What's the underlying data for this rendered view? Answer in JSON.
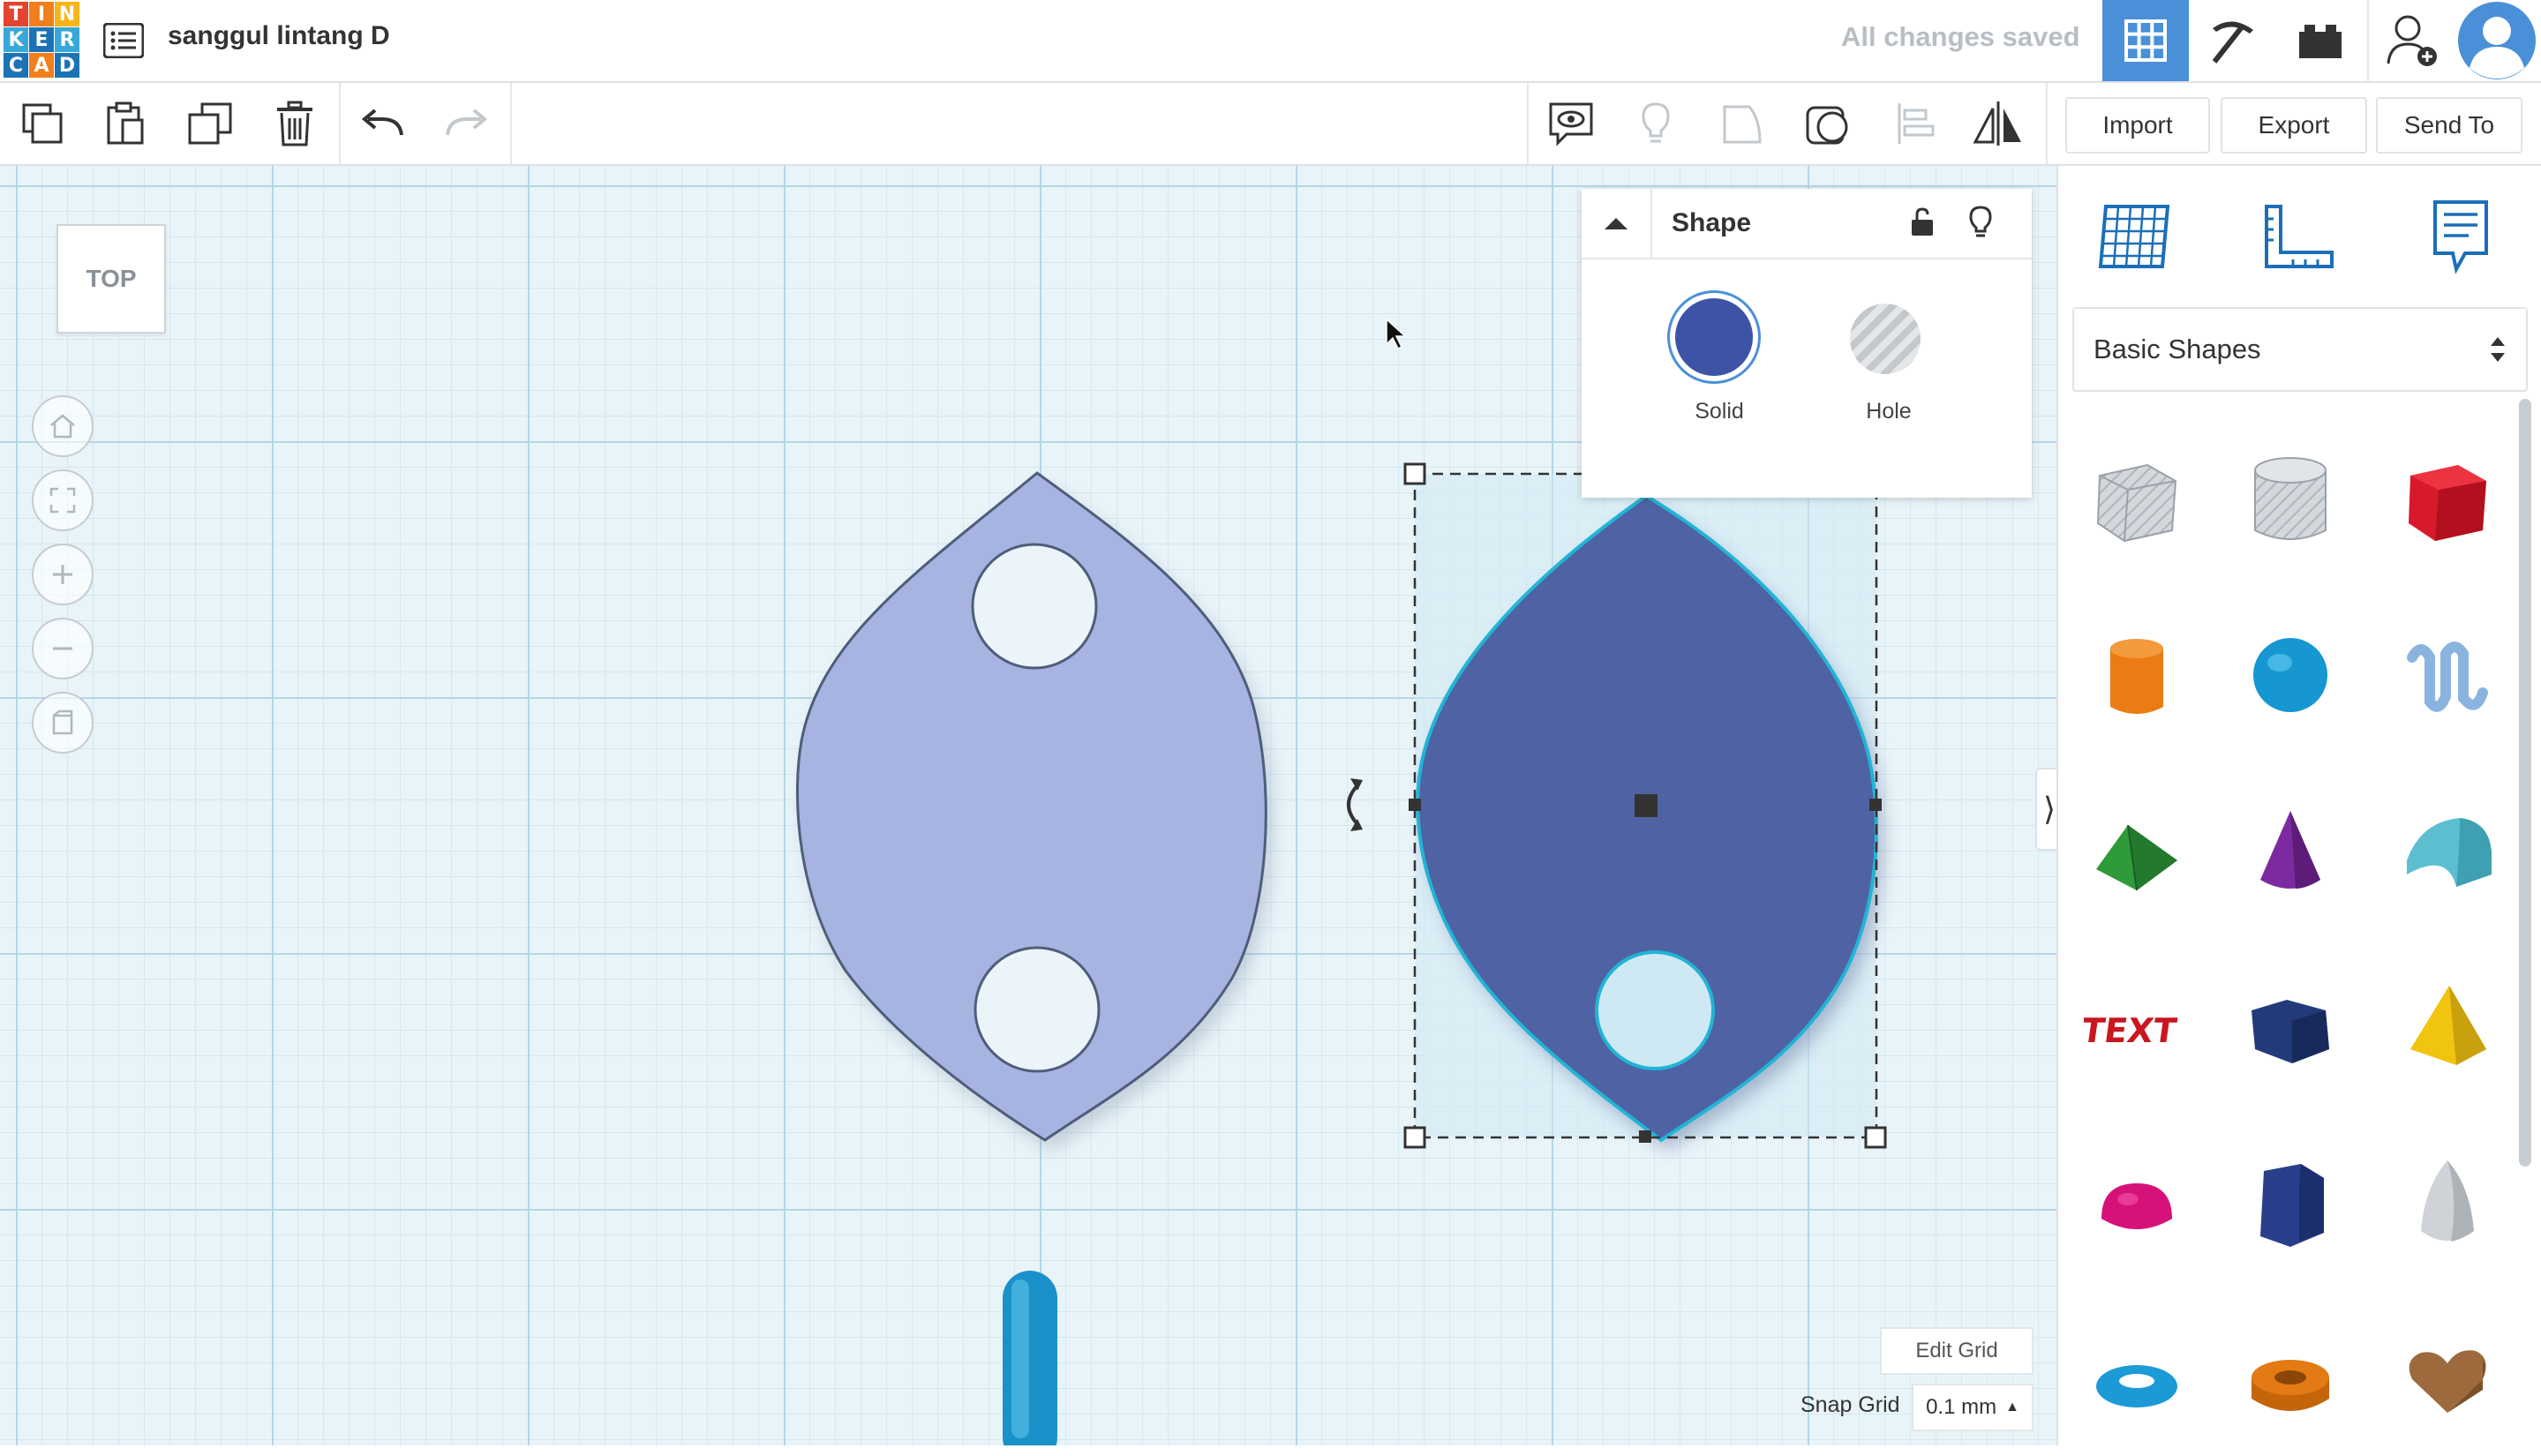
{
  "header": {
    "logo_letters": [
      "T",
      "I",
      "N",
      "K",
      "E",
      "R",
      "C",
      "A",
      "D"
    ],
    "logo_colors": [
      "#e2442f",
      "#f07f1c",
      "#f9b41a",
      "#38a8d8",
      "#1b73b5",
      "#38a8d8",
      "#1b73b5",
      "#f07f1c",
      "#1b73b5"
    ],
    "project_title": "sanggul lintang D",
    "save_status": "All changes saved",
    "active_view_color": "#4a90d9"
  },
  "toolbar": {
    "import_label": "Import",
    "export_label": "Export",
    "send_to_label": "Send To"
  },
  "workplane": {
    "view_cube_label": "TOP",
    "edit_grid_label": "Edit Grid",
    "snap_grid_label": "Snap Grid",
    "snap_grid_value": "0.1 mm"
  },
  "shape_panel": {
    "title": "Shape",
    "solid_label": "Solid",
    "hole_label": "Hole",
    "solid_color": "#3d54a6"
  },
  "shapes_library": {
    "category": "Basic Shapes",
    "items": [
      {
        "name": "Box Hole",
        "color": "#b9c0c8"
      },
      {
        "name": "Cylinder Hole",
        "color": "#b9c0c8"
      },
      {
        "name": "Box",
        "color": "#d7192c"
      },
      {
        "name": "Cylinder",
        "color": "#ea7c13"
      },
      {
        "name": "Sphere",
        "color": "#1697d1"
      },
      {
        "name": "Scribble",
        "color": "#8ab4e0"
      },
      {
        "name": "Roof",
        "color": "#2e9a3a"
      },
      {
        "name": "Cone",
        "color": "#7d2aa0"
      },
      {
        "name": "Round Roof",
        "color": "#5bbfd0"
      },
      {
        "name": "Text",
        "color": "#c8171f"
      },
      {
        "name": "Polygon",
        "color": "#233a7a"
      },
      {
        "name": "Pyramid",
        "color": "#f1c40f"
      },
      {
        "name": "Half Sphere",
        "color": "#d6127a"
      },
      {
        "name": "Hexagonal Prism",
        "color": "#2a3f8c"
      },
      {
        "name": "Paraboloid",
        "color": "#cfd3d7"
      },
      {
        "name": "Torus",
        "color": "#1b9ad6"
      },
      {
        "name": "Tube",
        "color": "#e37a14"
      },
      {
        "name": "Heart",
        "color": "#9c6a3c"
      }
    ]
  }
}
